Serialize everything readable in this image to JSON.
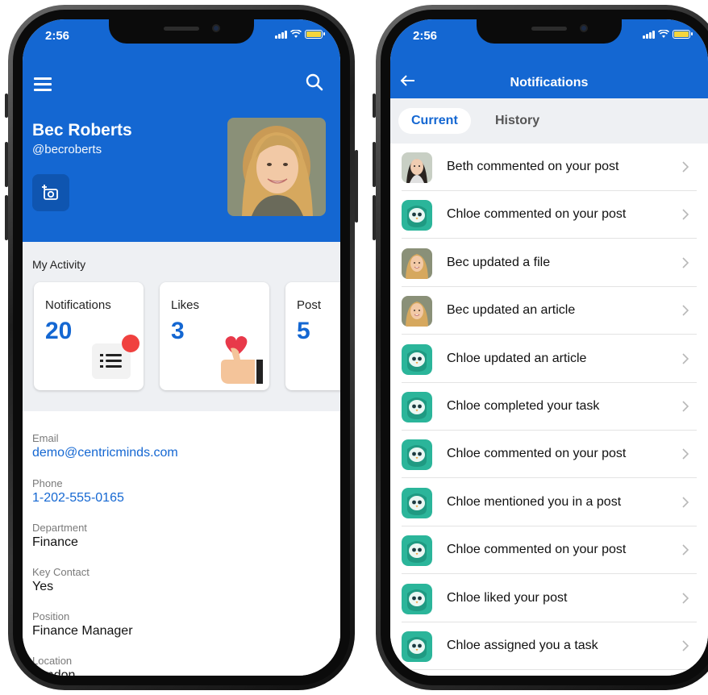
{
  "left_screen": {
    "status": {
      "time": "2:56"
    },
    "header": {
      "name": "Bec Roberts",
      "handle": "@becroberts"
    },
    "activity": {
      "title": "My Activity",
      "cards": [
        {
          "label": "Notifications",
          "value": "20"
        },
        {
          "label": "Likes",
          "value": "3"
        },
        {
          "label": "Post",
          "value": "5"
        }
      ]
    },
    "details": [
      {
        "label": "Email",
        "value": "demo@centricminds.com"
      },
      {
        "label": "Phone",
        "value": "1-202-555-0165"
      },
      {
        "label": "Department",
        "value": "Finance"
      },
      {
        "label": "Key Contact",
        "value": "Yes"
      },
      {
        "label": "Position",
        "value": "Finance Manager"
      },
      {
        "label": "Location",
        "value": "London"
      }
    ]
  },
  "right_screen": {
    "status": {
      "time": "2:56"
    },
    "title": "Notifications",
    "tabs": [
      {
        "label": "Current",
        "active": true
      },
      {
        "label": "History",
        "active": false
      }
    ],
    "notifications": [
      {
        "text": "Beth commented on your post",
        "avatar": "beth-photo"
      },
      {
        "text": "Chloe commented on your post",
        "avatar": "owl-icon"
      },
      {
        "text": "Bec updated a file",
        "avatar": "bec-photo"
      },
      {
        "text": "Bec updated an article",
        "avatar": "bec-photo"
      },
      {
        "text": "Chloe updated an article",
        "avatar": "owl-icon"
      },
      {
        "text": "Chloe completed your task",
        "avatar": "owl-icon"
      },
      {
        "text": "Chloe commented on your post",
        "avatar": "owl-icon"
      },
      {
        "text": "Chloe mentioned you in a post",
        "avatar": "owl-icon"
      },
      {
        "text": "Chloe commented on your post",
        "avatar": "owl-icon"
      },
      {
        "text": "Chloe liked your post",
        "avatar": "owl-icon"
      },
      {
        "text": "Chloe assigned you a task",
        "avatar": "owl-icon"
      }
    ]
  },
  "colors": {
    "brand_blue": "#1467d2",
    "owl_green": "#2bb59a",
    "badge_red": "#f0413f"
  }
}
